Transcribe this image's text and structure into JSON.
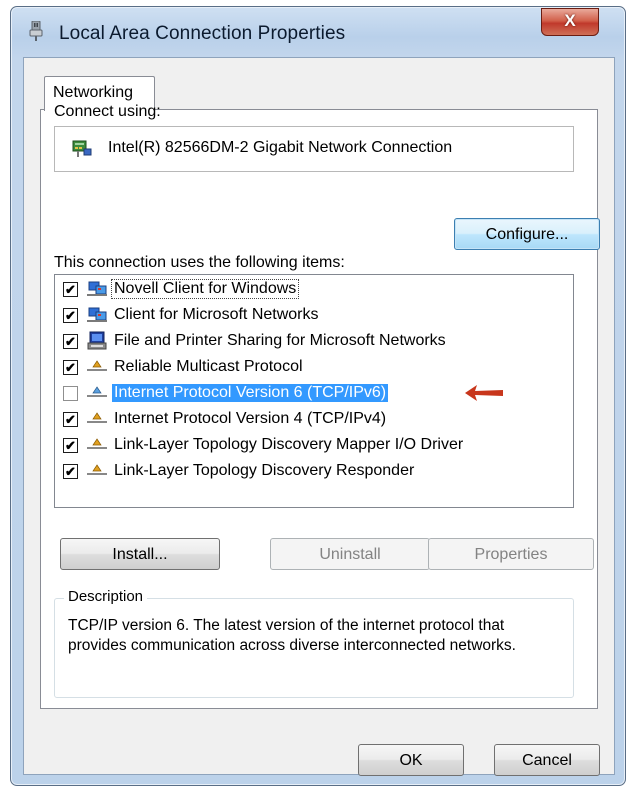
{
  "window": {
    "title": "Local Area Connection Properties",
    "close_label": "X"
  },
  "tabs": [
    {
      "label": "Networking",
      "selected": true
    }
  ],
  "connect_using": {
    "label": "Connect using:",
    "adapter": "Intel(R) 82566DM-2 Gigabit Network Connection",
    "configure_label": "Configure..."
  },
  "items_section": {
    "label": "This connection uses the following items:",
    "items": [
      {
        "label": "Novell Client for Windows",
        "checked": true,
        "icon": "network-client-icon"
      },
      {
        "label": "Client for Microsoft Networks",
        "checked": true,
        "icon": "network-client-icon"
      },
      {
        "label": "File and Printer Sharing for Microsoft Networks",
        "checked": true,
        "icon": "file-printer-sharing-icon"
      },
      {
        "label": "Reliable Multicast Protocol",
        "checked": true,
        "icon": "protocol-icon"
      },
      {
        "label": "Internet Protocol Version 6 (TCP/IPv6)",
        "checked": false,
        "icon": "protocol-icon",
        "selected": true
      },
      {
        "label": "Internet Protocol Version 4 (TCP/IPv4)",
        "checked": true,
        "icon": "protocol-icon"
      },
      {
        "label": "Link-Layer Topology Discovery Mapper I/O Driver",
        "checked": true,
        "icon": "protocol-icon"
      },
      {
        "label": "Link-Layer Topology Discovery Responder",
        "checked": true,
        "icon": "protocol-icon"
      }
    ]
  },
  "buttons": {
    "install": "Install...",
    "uninstall": "Uninstall",
    "properties": "Properties",
    "ok": "OK",
    "cancel": "Cancel"
  },
  "description": {
    "legend": "Description",
    "text": "TCP/IP version 6. The latest version of the internet protocol that provides communication across diverse interconnected networks."
  },
  "colors": {
    "selection": "#3399ff",
    "annotation_arrow": "#c8361c"
  }
}
